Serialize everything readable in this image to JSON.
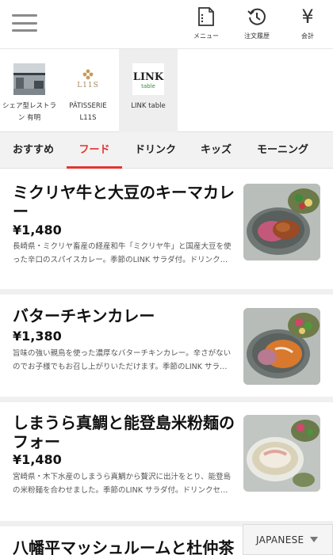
{
  "header": {
    "menu_label": "メニュー",
    "history_label": "注文履歴",
    "checkout_label": "会計",
    "checkout_glyph": "¥"
  },
  "stores": [
    {
      "name": "シェア型レストラン 有明",
      "icon": "restaurant-photo"
    },
    {
      "name": "PÂTISSERIE L11S",
      "icon": "patisserie-logo"
    },
    {
      "name": "LINK table",
      "icon": "link-table-logo",
      "active": true
    }
  ],
  "store_logos": {
    "patisserie_logo_text": "L11S",
    "link_table_logo_text": "LINK",
    "link_table_logo_sub": "table"
  },
  "tabs": [
    {
      "label": "おすすめ"
    },
    {
      "label": "フード",
      "active": true
    },
    {
      "label": "ドリンク"
    },
    {
      "label": "キッズ"
    },
    {
      "label": "モーニング"
    }
  ],
  "items": [
    {
      "title": "ミクリヤ牛と大豆のキーマカレー",
      "price": "¥1,480",
      "description": "長崎県・ミクリヤ畜産の経産和牛「ミクリヤ牛」と国産大豆を使った辛口のスパイスカレー。季節のLINK サラダ付。ドリンク…",
      "icon": "keema-curry-photo"
    },
    {
      "title": "バターチキンカレー",
      "price": "¥1,380",
      "description": "旨味の強い親鳥を使った濃厚なバターチキンカレー。辛さがないのでお子様でもお召し上がりいただけます。季節のLINK サラ…",
      "icon": "butter-chicken-photo"
    },
    {
      "title": "しまうら真鯛と能登島米粉麺のフォー",
      "price": "¥1,480",
      "description": "宮崎県・木下水産のしまうら真鯛から贅沢に出汁をとり、能登島の米粉麺を合わせました。季節のLINK サラダ付。ドリンクセ…",
      "icon": "pho-photo"
    },
    {
      "title": "八幡平マッシュルームと杜仲茶",
      "icon": "dish-photo"
    }
  ],
  "language": {
    "selected": "JAPANESE",
    "icon": "dropdown-arrow"
  },
  "colors": {
    "accent": "#e3342f",
    "tab_bar": "#f2f2f2",
    "active_store": "#eeeeee"
  }
}
